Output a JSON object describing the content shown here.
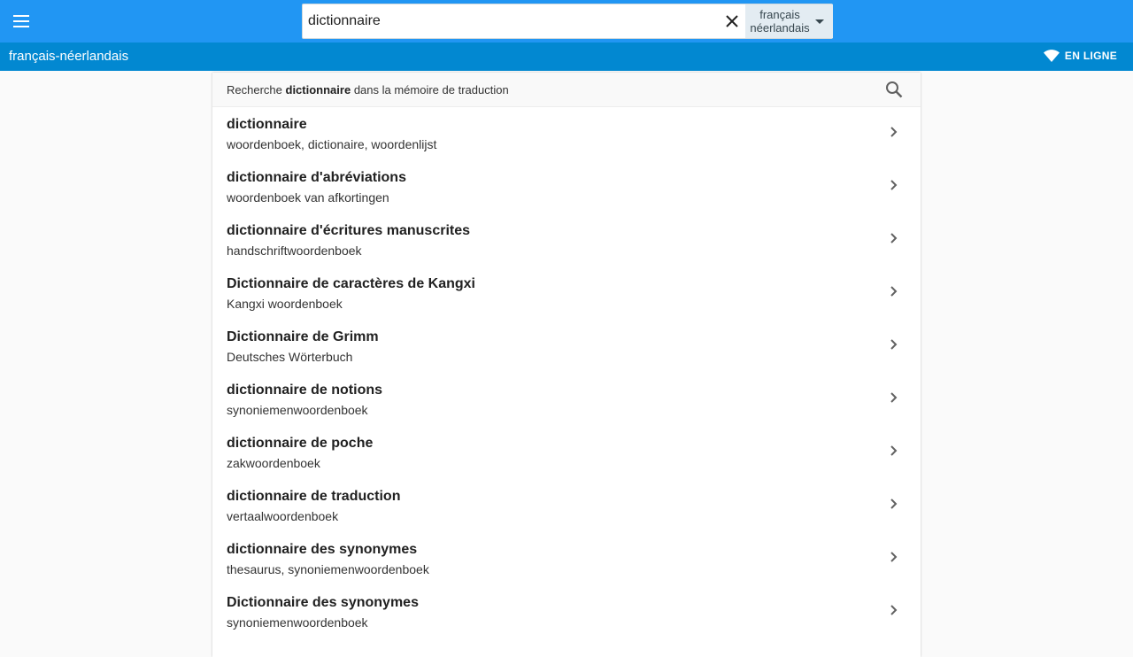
{
  "header": {
    "menu_icon": "menu-icon",
    "search_value": "dictionnaire",
    "clear_icon": "close-icon",
    "language": {
      "source": "français",
      "target": "néerlandais",
      "caret_icon": "caret-down-icon"
    }
  },
  "subheader": {
    "pair_label": "français-néerlandais",
    "status_icon": "wifi-icon",
    "status_label": "EN LIGNE"
  },
  "memory": {
    "prefix": "Recherche",
    "term": "dictionnaire",
    "suffix": "dans la mémoire de traduction",
    "icon": "search-icon"
  },
  "results": [
    {
      "term": "dictionnaire",
      "translation": "woordenboek, dictionaire, woordenlijst"
    },
    {
      "term": "dictionnaire d'abréviations",
      "translation": "woordenboek van afkortingen"
    },
    {
      "term": "dictionnaire d'écritures manuscrites",
      "translation": "handschriftwoordenboek"
    },
    {
      "term": "Dictionnaire de caractères de Kangxi",
      "translation": "Kangxi woordenboek"
    },
    {
      "term": "Dictionnaire de Grimm",
      "translation": "Deutsches Wörterbuch"
    },
    {
      "term": "dictionnaire de notions",
      "translation": "synoniemenwoordenboek"
    },
    {
      "term": "dictionnaire de poche",
      "translation": "zakwoordenboek"
    },
    {
      "term": "dictionnaire de traduction",
      "translation": "vertaalwoordenboek"
    },
    {
      "term": "dictionnaire des synonymes",
      "translation": "thesaurus, synoniemenwoordenboek"
    },
    {
      "term": "Dictionnaire des synonymes",
      "translation": "synoniemenwoordenboek"
    }
  ],
  "colors": {
    "primary": "#2196f3",
    "primary_dark": "#0288d1",
    "language_select_bg": "#e3ecf2"
  }
}
